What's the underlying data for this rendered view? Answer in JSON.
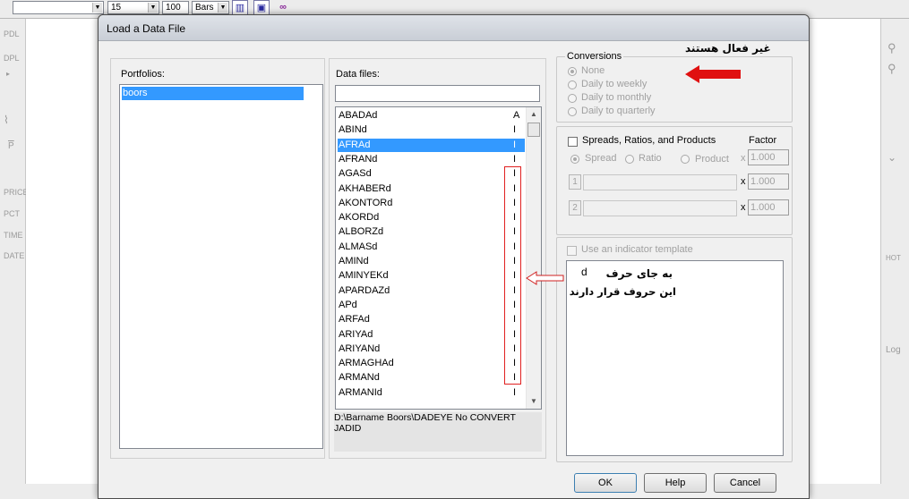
{
  "app": {
    "toolbar": {
      "combo1_value": "",
      "combo2_value": "15",
      "field3_value": "100",
      "combo4_value": "Bars"
    },
    "left_panel": [
      "PDL",
      "DPL",
      "PRICE",
      "PCT",
      "TIME",
      "DATE"
    ],
    "left_icon_p": "P",
    "right_panel": [
      "HOT",
      "Log"
    ]
  },
  "dialog": {
    "title": "Load a Data File",
    "portfolios_label": "Portfolios:",
    "portfolios": [
      {
        "name": "boors",
        "selected": true
      }
    ],
    "data_files_label": "Data files:",
    "data_files_filter": "",
    "files": [
      {
        "name": "ABADAd",
        "flag": "A",
        "selected": false
      },
      {
        "name": "ABINd",
        "flag": "I",
        "selected": false
      },
      {
        "name": "AFRAd",
        "flag": "I",
        "selected": true
      },
      {
        "name": "AFRANd",
        "flag": "I",
        "selected": false
      },
      {
        "name": "AGASd",
        "flag": "I",
        "selected": false
      },
      {
        "name": "AKHABERd",
        "flag": "I",
        "selected": false
      },
      {
        "name": "AKONTORd",
        "flag": "I",
        "selected": false
      },
      {
        "name": "AKORDd",
        "flag": "I",
        "selected": false
      },
      {
        "name": "ALBORZd",
        "flag": "I",
        "selected": false
      },
      {
        "name": "ALMASd",
        "flag": "I",
        "selected": false
      },
      {
        "name": "AMINd",
        "flag": "I",
        "selected": false
      },
      {
        "name": "AMINYEKd",
        "flag": "I",
        "selected": false
      },
      {
        "name": "APARDAZd",
        "flag": "I",
        "selected": false
      },
      {
        "name": "APd",
        "flag": "I",
        "selected": false
      },
      {
        "name": "ARFAd",
        "flag": "I",
        "selected": false
      },
      {
        "name": "ARIYAd",
        "flag": "I",
        "selected": false
      },
      {
        "name": "ARIYANd",
        "flag": "I",
        "selected": false
      },
      {
        "name": "ARMAGHAd",
        "flag": "I",
        "selected": false
      },
      {
        "name": "ARMANd",
        "flag": "I",
        "selected": false
      },
      {
        "name": "ARMANId",
        "flag": "I",
        "selected": false
      }
    ],
    "path": "D:\\Barname Boors\\DADEYE No CONVERT JADID",
    "conversions": {
      "title": "Conversions",
      "options": [
        {
          "label": "None",
          "selected": true
        },
        {
          "label": "Daily to weekly",
          "selected": false
        },
        {
          "label": "Daily to monthly",
          "selected": false
        },
        {
          "label": "Daily to quarterly",
          "selected": false
        }
      ]
    },
    "spreads": {
      "checkbox_label": "Spreads, Ratios, and Products",
      "factor_label": "Factor",
      "spread_label": "Spread",
      "ratio_label": "Ratio",
      "product_label": "Product",
      "times": "x",
      "btn1": "1",
      "btn2": "2",
      "factor1": "1.000",
      "factor2": "1.000",
      "factor3": "1.000"
    },
    "template": {
      "checkbox_label": "Use an indicator template"
    },
    "buttons": {
      "ok": "OK",
      "help": "Help",
      "cancel": "Cancel"
    }
  },
  "annotations": {
    "inactive_note": "غیر فعال هستند",
    "letter": "d",
    "instead_of": "به جای حرف",
    "these_letters": "این حروف قرار دارند"
  },
  "colors": {
    "selection": "#3399ff",
    "annotation_arrow": "#e01010"
  }
}
